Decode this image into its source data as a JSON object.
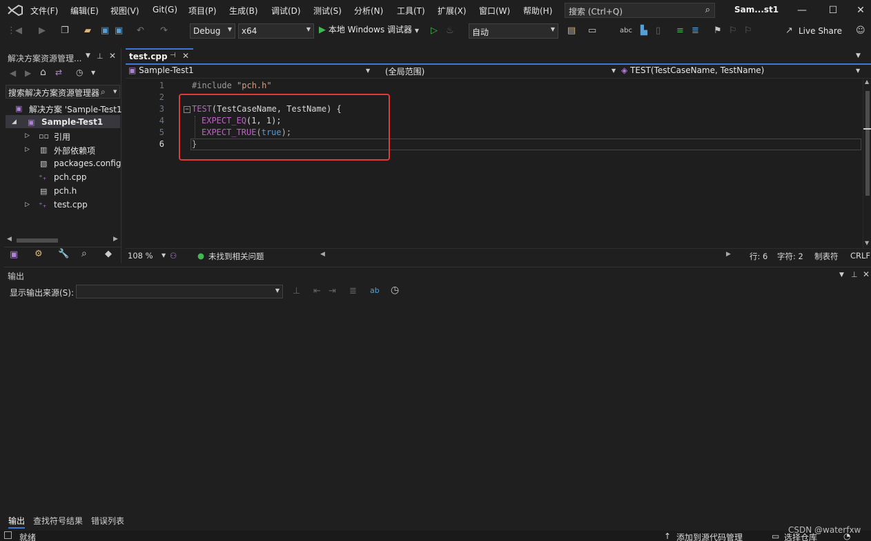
{
  "menubar": {
    "items": [
      "文件(F)",
      "编辑(E)",
      "视图(V)",
      "Git(G)",
      "项目(P)",
      "生成(B)",
      "调试(D)",
      "测试(S)",
      "分析(N)",
      "工具(T)",
      "扩展(X)",
      "窗口(W)",
      "帮助(H)"
    ],
    "search_placeholder": "搜索 (Ctrl+Q)",
    "window_title": "Sam...st1"
  },
  "toolbar": {
    "config": "Debug",
    "platform": "x64",
    "run_label": "本地 Windows 调试器",
    "auto_label": "自动",
    "live_share": "Live Share"
  },
  "solution_explorer": {
    "title": "解决方案资源管理...",
    "search_placeholder": "搜索解决方案资源管理器",
    "items": [
      {
        "label": "解决方案 'Sample-Test1"
      },
      {
        "label": "Sample-Test1"
      },
      {
        "label": "引用"
      },
      {
        "label": "外部依赖项"
      },
      {
        "label": "packages.config"
      },
      {
        "label": "pch.cpp"
      },
      {
        "label": "pch.h"
      },
      {
        "label": "test.cpp"
      }
    ]
  },
  "editor": {
    "tab_name": "test.cpp",
    "nav_project": "Sample-Test1",
    "nav_scope": "(全局范围)",
    "nav_member": "TEST(TestCaseName, TestName)",
    "line_numbers": [
      "1",
      "2",
      "3",
      "4",
      "5",
      "6"
    ],
    "code": {
      "l1_directive": "#include",
      "l1_string": "\"pch.h\"",
      "l3_macro": "TEST",
      "l3_args": "(TestCaseName, TestName) {",
      "l4_macro": "EXPECT_EQ",
      "l4_args": "(1, 1);",
      "l5_macro": "EXPECT_TRUE",
      "l5_open": "(",
      "l5_bool": "true",
      "l5_close": ");",
      "l6": "}"
    },
    "zoom": "108 %",
    "issues": "未找到相关问题",
    "line": "行: 6",
    "char": "字符: 2",
    "tabs": "制表符",
    "eol": "CRLF"
  },
  "output": {
    "title": "输出",
    "source_label": "显示输出来源(S):"
  },
  "bottom_tabs": [
    "输出",
    "查找符号结果",
    "错误列表"
  ],
  "statusbar": {
    "ready": "就绪",
    "add_source": "添加到源代码管理",
    "select_repo": "选择仓库"
  },
  "watermark": "CSDN @waterfxw",
  "colors": {
    "accent": "#3b78d8",
    "highlight_box": "#e53935",
    "macro": "#bd63c5",
    "string": "#d69d85"
  }
}
